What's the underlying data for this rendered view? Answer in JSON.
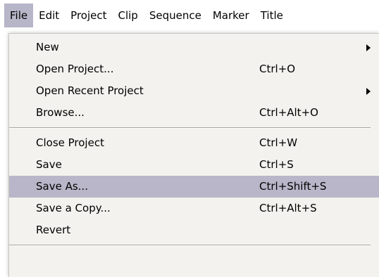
{
  "menubar": {
    "items": [
      {
        "label": "File",
        "active": true
      },
      {
        "label": "Edit"
      },
      {
        "label": "Project"
      },
      {
        "label": "Clip"
      },
      {
        "label": "Sequence"
      },
      {
        "label": "Marker"
      },
      {
        "label": "Title"
      }
    ]
  },
  "file_menu": {
    "groups": [
      [
        {
          "label": "New",
          "shortcut": "",
          "submenu": true
        },
        {
          "label": "Open Project...",
          "shortcut": "Ctrl+O"
        },
        {
          "label": "Open Recent Project",
          "shortcut": "",
          "submenu": true
        },
        {
          "label": "Browse...",
          "shortcut": "Ctrl+Alt+O"
        }
      ],
      [
        {
          "label": "Close Project",
          "shortcut": "Ctrl+W"
        },
        {
          "label": "Save",
          "shortcut": "Ctrl+S"
        },
        {
          "label": "Save As...",
          "shortcut": "Ctrl+Shift+S",
          "highlighted": true
        },
        {
          "label": "Save a Copy...",
          "shortcut": "Ctrl+Alt+S"
        },
        {
          "label": "Revert",
          "shortcut": ""
        }
      ]
    ]
  },
  "colors": {
    "highlight": "#b8b6c8",
    "menu_background": "#f3f2ee",
    "menubar_background": "#ffffff"
  }
}
